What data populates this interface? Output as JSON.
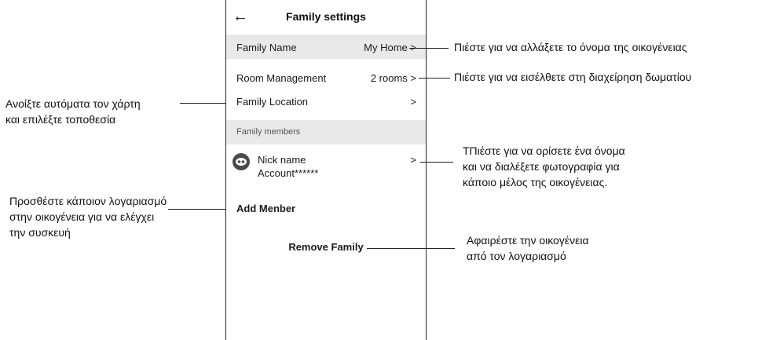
{
  "screen": {
    "back_icon": "arrow-left-icon",
    "title": "Family settings",
    "family_name": {
      "label": "Family Name",
      "value": "My Home >"
    },
    "room_management": {
      "label": "Room Management",
      "value": "2 rooms >"
    },
    "family_location": {
      "label": "Family Location",
      "value": ">"
    },
    "family_members_header": "Family members",
    "member": {
      "name": "Nick name",
      "account": "Account******",
      "chevron": ">"
    },
    "add_member": "Add Menber",
    "remove_family": "Remove Family"
  },
  "annotations": {
    "family_name": "Πιέστε για να αλλάξετε το όνομα της οικογένειας",
    "room_management": "Πιέστε για να εισέλθετε στη διαχείρηση δωματίου",
    "location": [
      "Ανοίξτε αυτόματα τον χάρτη",
      "και επιλέξτε τοποθεσία"
    ],
    "member": [
      "ΤΠιέστε για να ορίσετε ένα όνομα",
      "και να διαλέξετε φωτογραφία για",
      "κάποιο μέλος της οικογένειας."
    ],
    "add_member": [
      "Προσθέστε κάποιον λογαριασμό",
      "στην οικογένεια για να ελέγχει",
      "την συσκευή"
    ],
    "remove_family": [
      "Αφαιρέστε την οικογένεια",
      "από τον λογαριασμό"
    ]
  }
}
